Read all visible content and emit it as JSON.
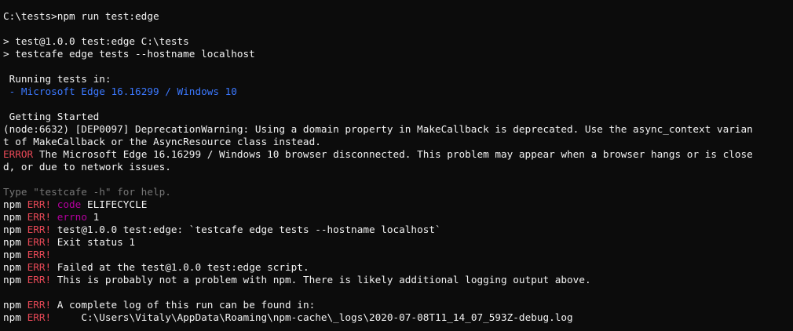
{
  "terminal": {
    "prompt_line": "C:\\tests>npm run test:edge",
    "script_header_1": "> test@1.0.0 test:edge C:\\tests",
    "script_header_2": "> testcafe edge tests --hostname localhost",
    "running_tests_label": " Running tests in:",
    "browser_dash": " - ",
    "browser_name": "Microsoft Edge 16.16299 / Windows 10",
    "fixture_name": " Getting Started",
    "deprecation_line_1": "(node:6632) [DEP0097] DeprecationWarning: Using a domain property in MakeCallback is deprecated. Use the async_context varian",
    "deprecation_line_2": "t of MakeCallback or the AsyncResource class instead.",
    "error_tag": "ERROR",
    "error_text_1": " The Microsoft Edge 16.16299 / Windows 10 browser disconnected. This problem may appear when a browser hangs or is close",
    "error_text_2": "d, or due to network issues.",
    "help_hint": "Type \"testcafe -h\" for help.",
    "npm_prefix": "npm ",
    "err_tag": "ERR!",
    "npm_err_lines": [
      {
        "key": "code",
        "value": " ELIFECYCLE"
      },
      {
        "key": "errno",
        "value": " 1"
      },
      {
        "key": "",
        "value": " test@1.0.0 test:edge: `testcafe edge tests --hostname localhost`"
      },
      {
        "key": "",
        "value": " Exit status 1"
      },
      {
        "key": "",
        "value": ""
      },
      {
        "key": "",
        "value": " Failed at the test@1.0.0 test:edge script."
      },
      {
        "key": "",
        "value": " This is probably not a problem with npm. There is likely additional logging output above."
      }
    ],
    "npm_log_lines": [
      {
        "key": "",
        "value": " A complete log of this run can be found in:"
      },
      {
        "key": "",
        "value": "     C:\\Users\\Vitaly\\AppData\\Roaming\\npm-cache\\_logs\\2020-07-08T11_14_07_593Z-debug.log"
      }
    ],
    "colors": {
      "background": "#0c0c0c",
      "foreground": "#cccccc",
      "bright_white": "#f2f2f2",
      "blue": "#3b78ff",
      "red": "#e74856",
      "magenta": "#b4009e",
      "gray": "#767676"
    }
  }
}
